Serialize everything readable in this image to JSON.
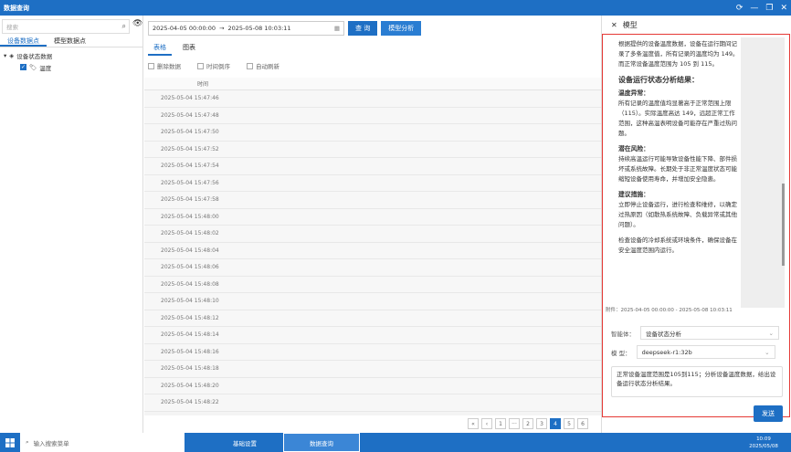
{
  "window": {
    "title": "数据查询"
  },
  "left": {
    "search_placeholder": "搜索",
    "tabs": [
      "设备数据点",
      "模型数据点"
    ],
    "tree": {
      "group": "设备状态数据",
      "item": "温度"
    }
  },
  "toolbar": {
    "start": "2025-04-05 00:00:00",
    "sep": "→",
    "end": "2025-05-08 10:03:11",
    "query": "查 询",
    "analyze": "模型分析"
  },
  "main": {
    "tabs": [
      "表格",
      "图表"
    ],
    "options": [
      "删除数据",
      "时间倒序",
      "自动刷新"
    ],
    "time_header": "时间",
    "rows": [
      "2025-05-04 15:47:46",
      "2025-05-04 15:47:48",
      "2025-05-04 15:47:50",
      "2025-05-04 15:47:52",
      "2025-05-04 15:47:54",
      "2025-05-04 15:47:56",
      "2025-05-04 15:47:58",
      "2025-05-04 15:48:00",
      "2025-05-04 15:48:02",
      "2025-05-04 15:48:04",
      "2025-05-04 15:48:06",
      "2025-05-04 15:48:08",
      "2025-05-04 15:48:10",
      "2025-05-04 15:48:12",
      "2025-05-04 15:48:14",
      "2025-05-04 15:48:16",
      "2025-05-04 15:48:18",
      "2025-05-04 15:48:20",
      "2025-05-04 15:48:22"
    ],
    "pager": [
      "«",
      "‹",
      "1",
      "···",
      "2",
      "3",
      "4",
      "5",
      "6"
    ],
    "active_page": "4"
  },
  "panel": {
    "title": "模型",
    "intro": "根据提供的设备温度数据，设备在运行期间记录了多条温度值，所有记录的温度均为 149。而正常设备温度范围为 105 到 115。",
    "heading": "设备运行状态分析结果：",
    "s1_title": "温度异常：",
    "s1_body": "所有记录的温度值均显著高于正常范围上限（115）。实际温度高达 149，远超正常工作范围，这种高温表明设备可能存在严重过热问题。",
    "s2_title": "潜在风险：",
    "s2_body": "持续高温运行可能导致设备性能下降、部件损坏或系统故障。长期处于非正常温度状态可能缩短设备使用寿命，并增加安全隐患。",
    "s3_title": "建议措施：",
    "s3_body1": "立即停止设备运行，进行检查和维修，以确定过热原因（如散热系统故障、负载异常或其他问题）。",
    "s3_body2": "检查设备的冷却系统或环境条件，确保设备在安全温度范围内运行。",
    "attach": "附件：2025-04-05 00:00:00 - 2025-05-08 10:03:11",
    "agent_label": "智能体：",
    "agent_value": "设备状态分析",
    "model_label": "模  型：",
    "model_value": "deepseek-r1:32b",
    "prompt": "正常设备温度范围是105到115；分析设备温度数据，给出设备运行状态分析结果。",
    "send": "发送"
  },
  "taskbar": {
    "search_placeholder": "输入搜索菜单",
    "btn1": "基础设置",
    "btn2": "数据查询",
    "time": "10:09",
    "date": "2025/05/08"
  },
  "colors": {
    "primary": "#1e6fc4",
    "alert": "#e53935"
  }
}
